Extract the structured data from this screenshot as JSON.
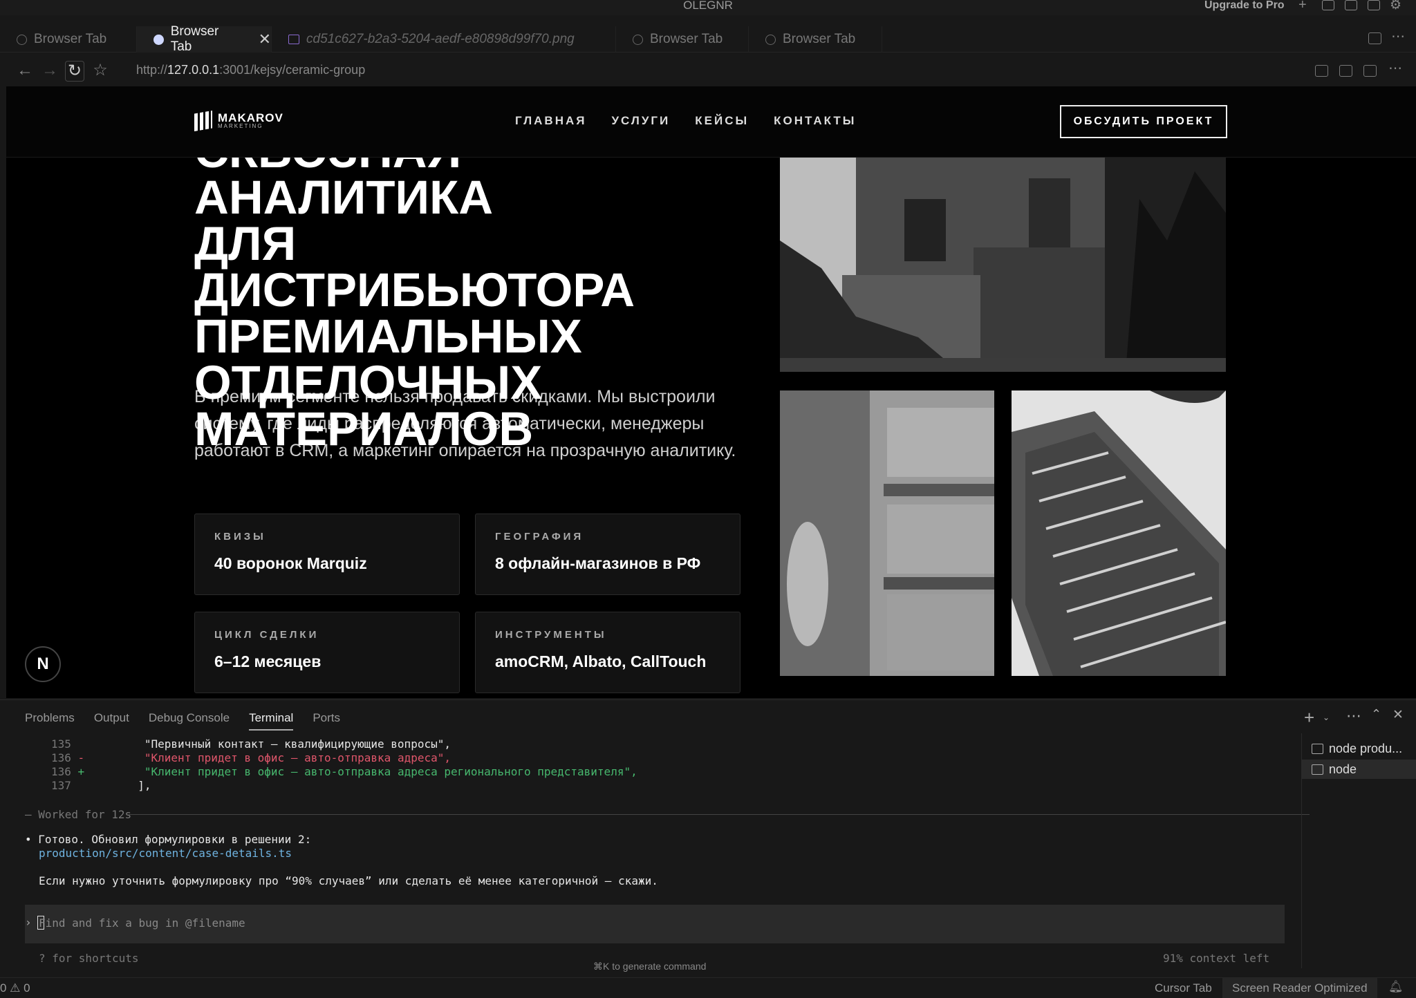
{
  "titlebar": {
    "title": "OLEGNR",
    "upgrade": "Upgrade to Pro"
  },
  "tabs": [
    {
      "label": "Browser Tab"
    },
    {
      "label": "Browser Tab",
      "close": "✕"
    },
    {
      "label": "cd51c627-b2a3-5204-aedf-e80898d99f70.png"
    },
    {
      "label": "Browser Tab"
    },
    {
      "label": "Browser Tab"
    }
  ],
  "address": {
    "prefix": "http://",
    "host": "127.0.0.1",
    "path": ":3001/kejsy/ceramic-group"
  },
  "site": {
    "logo_name": "MAKAROV",
    "logo_sub": "MARKETING",
    "nav": [
      "ГЛАВНАЯ",
      "УСЛУГИ",
      "КЕЙСЫ",
      "КОНТАКТЫ"
    ],
    "cta": "ОБСУДИТЬ ПРОЕКТ",
    "hero": "СКВОЗНАЯ АНАЛИТИКА\nДЛЯ ДИСТРИБЬЮТОРА\nПРЕМИАЛЬНЫХ\nОТДЕЛОЧНЫХ\nМАТЕРИАЛОВ",
    "lead": "В премиум-сегменте нельзя продавать скидками. Мы выстроили систему, где лиды распределяются автоматически, менеджеры работают в CRM, а маркетинг опирается на прозрачную аналитику.",
    "stats": [
      {
        "label": "КВИЗЫ",
        "value": "40 воронок Marquiz"
      },
      {
        "label": "ГЕОГРАФИЯ",
        "value": "8 офлайн-магазинов в РФ"
      },
      {
        "label": "ЦИКЛ СДЕЛКИ",
        "value": "6–12 месяцев"
      },
      {
        "label": "ИНСТРУМЕНТЫ",
        "value": "amoCRM, Albato, CallTouch"
      }
    ],
    "badge": "N"
  },
  "panel": {
    "tabs": [
      "Problems",
      "Output",
      "Debug Console",
      "Terminal",
      "Ports"
    ],
    "active_tab": "Terminal",
    "diff": [
      {
        "num": "135",
        "mark": " ",
        "text": "\"Первичный контакт — квалифицирующие вопросы\","
      },
      {
        "num": "136",
        "mark": "-",
        "text": "\"Клиент придет в офис — авто-отправка адреса\","
      },
      {
        "num": "136",
        "mark": "+",
        "text": "\"Клиент придет в офис — авто-отправка адреса регионального представителя\","
      },
      {
        "num": "137",
        "mark": " ",
        "text": "],"
      }
    ],
    "worked": "— Worked for 12s",
    "done_line": "• Готово. Обновил формулировки в решении 2:",
    "done_path": "production/src/content/case-details.ts",
    "note": "Если нужно уточнить формулировку про “90% случаев” или сделать её менее категоричной — скажи.",
    "prompt_placeholder": "Find and fix a bug in @filename",
    "shortcuts": "? for shortcuts",
    "context": "91% context left",
    "generate_hint": "⌘K to generate command",
    "terminals": [
      "node produ...",
      "node"
    ]
  },
  "status": {
    "problems": "0 ⚠ 0",
    "cursor_tab": "Cursor Tab",
    "screen_reader": "Screen Reader Optimized"
  }
}
